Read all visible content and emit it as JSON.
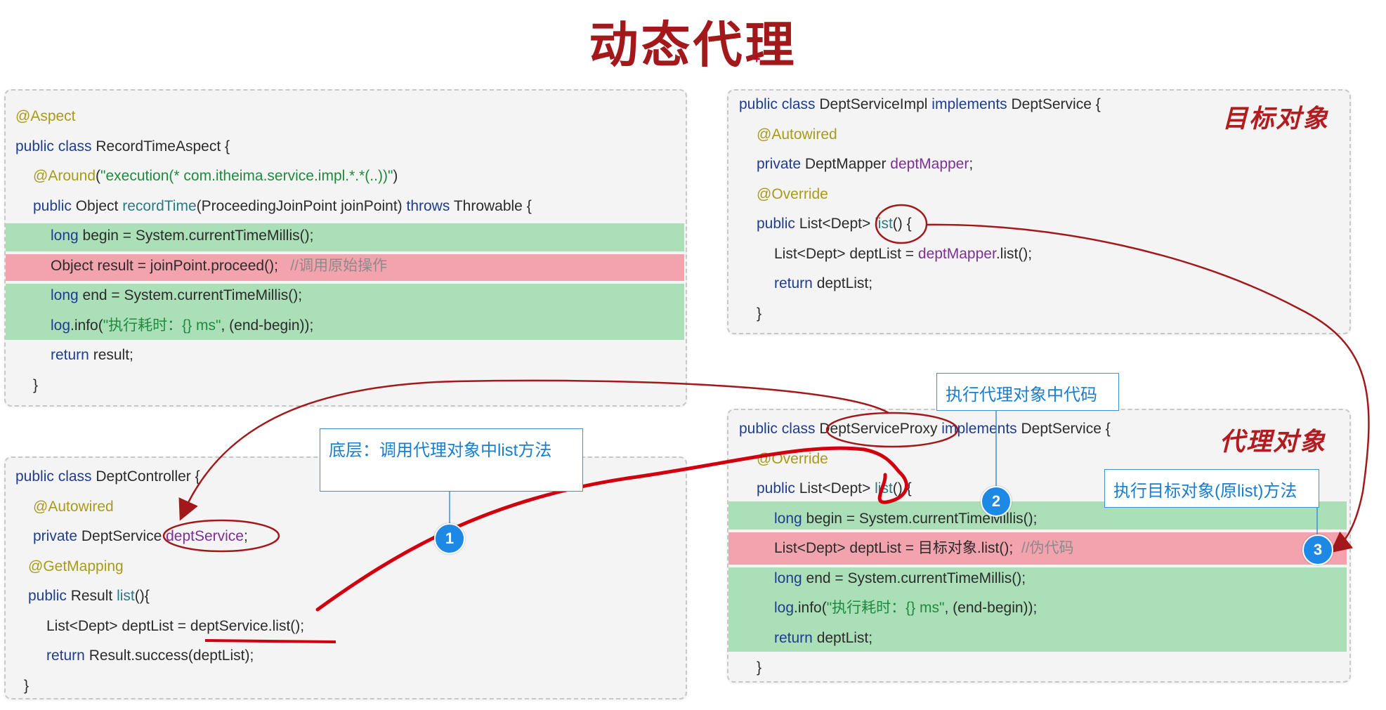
{
  "title": "动态代理",
  "plus_mark": "+",
  "aspect_panel": [
    [
      {
        "t": "@Aspect",
        "c": "an"
      }
    ],
    [
      {
        "t": "public class ",
        "c": "kw"
      },
      {
        "t": "RecordTimeAspect {",
        "c": ""
      }
    ],
    [
      {
        "t": "@Around",
        "c": "an"
      },
      {
        "t": "(",
        "c": ""
      },
      {
        "t": "\"execution(* com.itheima.service.impl.*.*(..))\"",
        "c": "str"
      },
      {
        "t": ")",
        "c": ""
      }
    ],
    [
      {
        "t": "public ",
        "c": "kw"
      },
      {
        "t": "Object ",
        "c": ""
      },
      {
        "t": "recordTime",
        "c": "fn"
      },
      {
        "t": "(ProceedingJoinPoint joinPoint) ",
        "c": ""
      },
      {
        "t": "throws ",
        "c": "kw"
      },
      {
        "t": "Throwable {",
        "c": ""
      }
    ],
    [
      {
        "t": "long ",
        "c": "kw"
      },
      {
        "t": "begin = System.",
        "c": ""
      },
      {
        "t": "currentTimeMillis",
        "c": ""
      },
      {
        "t": "();",
        "c": ""
      }
    ],
    [
      {
        "t": "Object result = joinPoint.proceed();   ",
        "c": ""
      },
      {
        "t": "//调用原始操作",
        "c": "cm"
      }
    ],
    [
      {
        "t": "long ",
        "c": "kw"
      },
      {
        "t": "end = System.currentTimeMillis();",
        "c": ""
      }
    ],
    [
      {
        "t": "log",
        "c": "kw"
      },
      {
        "t": ".info(",
        "c": ""
      },
      {
        "t": "\"执行耗时：{} ms\"",
        "c": "str"
      },
      {
        "t": ", (end-begin));",
        "c": ""
      }
    ],
    [
      {
        "t": "return ",
        "c": "kw"
      },
      {
        "t": "result;",
        "c": ""
      }
    ],
    [
      {
        "t": "}",
        "c": ""
      }
    ]
  ],
  "controller_panel": [
    [
      {
        "t": "public class ",
        "c": "kw"
      },
      {
        "t": "DeptController {",
        "c": ""
      }
    ],
    [
      {
        "t": "@Autowired",
        "c": "an"
      }
    ],
    [
      {
        "t": "private ",
        "c": "kw"
      },
      {
        "t": "DeptService ",
        "c": ""
      },
      {
        "t": "deptService",
        "c": "fld"
      },
      {
        "t": ";",
        "c": ""
      }
    ],
    [
      {
        "t": "@GetMapping",
        "c": "an"
      }
    ],
    [
      {
        "t": "public ",
        "c": "kw"
      },
      {
        "t": "Result ",
        "c": ""
      },
      {
        "t": "list",
        "c": "fn"
      },
      {
        "t": "(){",
        "c": ""
      }
    ],
    [
      {
        "t": "List<Dept> deptList = deptService.list();",
        "c": ""
      }
    ],
    [
      {
        "t": "return ",
        "c": "kw"
      },
      {
        "t": "Result.success(deptList);",
        "c": ""
      }
    ],
    [
      {
        "t": "}",
        "c": ""
      }
    ]
  ],
  "target_panel": [
    [
      {
        "t": "public class ",
        "c": "kw"
      },
      {
        "t": "DeptServiceImpl ",
        "c": ""
      },
      {
        "t": "implements ",
        "c": "kw"
      },
      {
        "t": "DeptService {",
        "c": ""
      }
    ],
    [
      {
        "t": "@Autowired",
        "c": "an"
      }
    ],
    [
      {
        "t": "private ",
        "c": "kw"
      },
      {
        "t": "DeptMapper ",
        "c": ""
      },
      {
        "t": "deptMapper",
        "c": "fld"
      },
      {
        "t": ";",
        "c": ""
      }
    ],
    [
      {
        "t": "@Override",
        "c": "an"
      }
    ],
    [
      {
        "t": "public ",
        "c": "kw"
      },
      {
        "t": "List<Dept> ",
        "c": ""
      },
      {
        "t": "list",
        "c": "fn"
      },
      {
        "t": "() {",
        "c": ""
      }
    ],
    [
      {
        "t": "List<Dept> deptList = ",
        "c": ""
      },
      {
        "t": "deptMapper",
        "c": "fld"
      },
      {
        "t": ".list();",
        "c": ""
      }
    ],
    [
      {
        "t": "return ",
        "c": "kw"
      },
      {
        "t": "deptList;",
        "c": ""
      }
    ],
    [
      {
        "t": "}",
        "c": ""
      }
    ]
  ],
  "proxy_panel": [
    [
      {
        "t": "public class ",
        "c": "kw"
      },
      {
        "t": "DeptServiceProxy ",
        "c": ""
      },
      {
        "t": "implements ",
        "c": "kw"
      },
      {
        "t": "DeptService {",
        "c": ""
      }
    ],
    [
      {
        "t": "@Override",
        "c": "an"
      }
    ],
    [
      {
        "t": "public ",
        "c": "kw"
      },
      {
        "t": "List<Dept> ",
        "c": ""
      },
      {
        "t": "list",
        "c": "fn"
      },
      {
        "t": "() {",
        "c": ""
      }
    ],
    [
      {
        "t": "long ",
        "c": "kw"
      },
      {
        "t": "begin = System.currentTimeMillis();",
        "c": ""
      }
    ],
    [
      {
        "t": "List<Dept> deptList = 目标对象.list();  ",
        "c": ""
      },
      {
        "t": "//伪代码",
        "c": "cm"
      }
    ],
    [
      {
        "t": "long ",
        "c": "kw"
      },
      {
        "t": "end = System.currentTimeMillis();",
        "c": ""
      }
    ],
    [
      {
        "t": "log",
        "c": "kw"
      },
      {
        "t": ".info(",
        "c": ""
      },
      {
        "t": "\"执行耗时：{} ms\"",
        "c": "str"
      },
      {
        "t": ", (end-begin));",
        "c": ""
      }
    ],
    [
      {
        "t": "return ",
        "c": "kw"
      },
      {
        "t": "deptList;",
        "c": ""
      }
    ],
    [
      {
        "t": "}",
        "c": ""
      }
    ]
  ],
  "tags": {
    "target": "目标对象",
    "proxy": "代理对象"
  },
  "callouts": {
    "c1": "底层：调用代理对象中list方法",
    "c2": "执行代理对象中代码",
    "c3": "执行目标对象(原list)方法"
  },
  "badges": {
    "b1": "1",
    "b2": "2",
    "b3": "3"
  },
  "colors": {
    "annotation_red": "#b21c20",
    "callout_blue": "#1e88e5",
    "green_highlight": "#abdfb8",
    "red_highlight": "#f2a3ad"
  }
}
